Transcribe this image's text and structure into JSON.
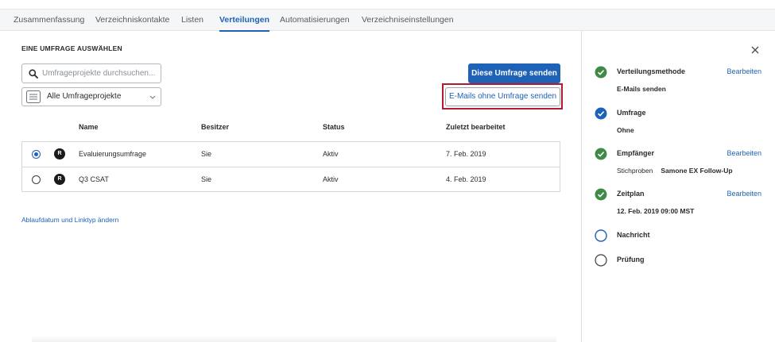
{
  "tabs": [
    {
      "label": "Zusammenfassung",
      "active": false
    },
    {
      "label": "Verzeichniskontakte",
      "active": false
    },
    {
      "label": "Listen",
      "active": false
    },
    {
      "label": "Verteilungen",
      "active": true
    },
    {
      "label": "Automatisierungen",
      "active": false
    },
    {
      "label": "Verzeichniseinstellungen",
      "active": false
    }
  ],
  "main": {
    "section_title": "EINE UMFRAGE AUSWÄHLEN",
    "search": {
      "placeholder": "Umfrageprojekte durchsuchen...",
      "value": "",
      "icon": "search-icon"
    },
    "filter": {
      "selected": "Alle Umfrageprojekte",
      "icon": "list-icon"
    },
    "send_survey_button": "Diese Umfrage senden",
    "send_without_survey_button": "E-Mails ohne Umfrage senden",
    "table": {
      "headers": [
        "Name",
        "Besitzer",
        "Status",
        "Zuletzt bearbeitet"
      ],
      "rows": [
        {
          "badge": "R",
          "name": "Evaluierungsumfrage",
          "owner": "Sie",
          "status": "Aktiv",
          "edited": "7. Feb. 2019",
          "selected": true
        },
        {
          "badge": "R",
          "name": "Q3 CSAT",
          "owner": "Sie",
          "status": "Aktiv",
          "edited": "4. Feb. 2019",
          "selected": false
        }
      ]
    },
    "link": "Ablaufdatum und Linktyp ändern"
  },
  "panel": {
    "close_icon": "close-icon",
    "edit_label": "Bearbeiten",
    "steps": [
      {
        "title": "Verteilungsmethode",
        "detail": "E-Mails senden",
        "state": "complete-green",
        "editable": true
      },
      {
        "title": "Umfrage",
        "detail": "Ohne",
        "state": "complete-blue",
        "editable": false
      },
      {
        "title": "Empfänger",
        "detail": "Stichproben",
        "detail_bold": "Samone EX Follow-Up",
        "state": "complete-green",
        "editable": true
      },
      {
        "title": "Zeitplan",
        "detail": "12. Feb. 2019 09:00 MST",
        "state": "complete-green",
        "editable": true
      },
      {
        "title": "Nachricht",
        "detail": "",
        "state": "pending",
        "editable": false
      },
      {
        "title": "Prüfung",
        "detail": "",
        "state": "pending",
        "editable": false
      }
    ]
  },
  "colors": {
    "accent": "#1d62b7",
    "success": "#3f8a47",
    "highlight": "#b01c2e"
  }
}
